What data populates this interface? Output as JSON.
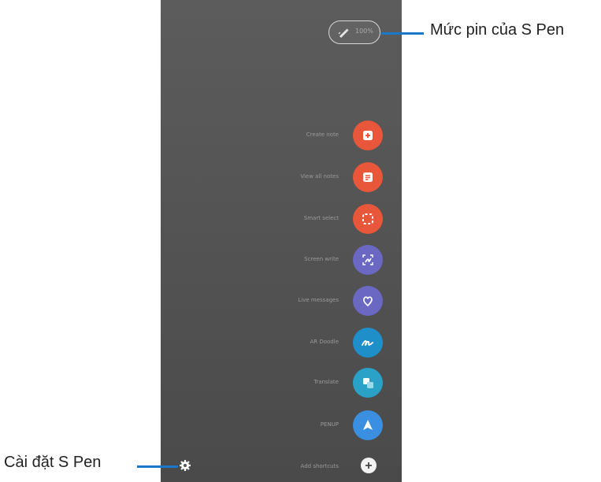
{
  "battery": {
    "percent_text": "100%"
  },
  "menu": [
    {
      "label": "Create note",
      "icon": "create-note-icon",
      "color": "#e8573a"
    },
    {
      "label": "View all notes",
      "icon": "view-all-notes-icon",
      "color": "#e8573a"
    },
    {
      "label": "Smart select",
      "icon": "smart-select-icon",
      "color": "#e8573a"
    },
    {
      "label": "Screen write",
      "icon": "screen-write-icon",
      "color": "#6b68c4"
    },
    {
      "label": "Live messages",
      "icon": "live-messages-icon",
      "color": "#6b68c4"
    },
    {
      "label": "AR Doodle",
      "icon": "ar-doodle-icon",
      "color": "#1f8fc9"
    },
    {
      "label": "Translate",
      "icon": "translate-icon",
      "color": "#2aa2c8"
    },
    {
      "label": "PENUP",
      "icon": "penup-icon",
      "color": "#3a8fe0"
    },
    {
      "label": "Add shortcuts",
      "icon": "add-shortcuts-icon",
      "color": "#f2f2f2"
    }
  ],
  "callouts": {
    "battery_label": "Mức pin của S Pen",
    "settings_label": "Cài đặt S Pen"
  },
  "colors": {
    "leader": "#1b77c7",
    "panel": "#555555"
  }
}
